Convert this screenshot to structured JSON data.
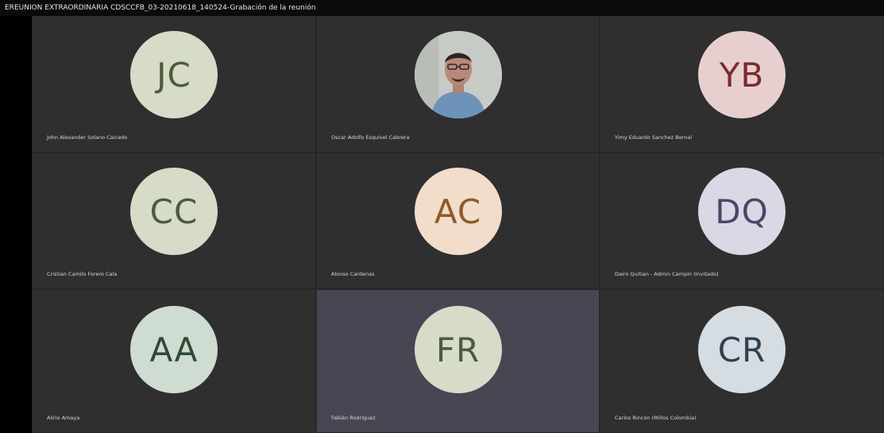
{
  "window": {
    "title": "EREUNION EXTRAORDINARIA CDSCCFB_03-20210618_140524-Grabación de la reunión"
  },
  "participants": [
    {
      "initials": "JC",
      "name": "John Alexander Solano Caicedo",
      "bg": "#d7dcc8",
      "fg": "#4e5a3a"
    },
    {
      "initials": "",
      "name": "Oscar Adolfo Esquivel Cabrera",
      "bg": "#c9ccc9",
      "fg": "#000000"
    },
    {
      "initials": "YB",
      "name": "Yimy Eduardo Sanchez Bernal",
      "bg": "#e8cfcf",
      "fg": "#7a2a2e"
    },
    {
      "initials": "CC",
      "name": "Cristian Camilo Forero Cala",
      "bg": "#d7dcc8",
      "fg": "#4e5a3a"
    },
    {
      "initials": "AC",
      "name": "Alonso Cardenas",
      "bg": "#f2ddcb",
      "fg": "#8e5a2c"
    },
    {
      "initials": "DQ",
      "name": "Dairo Quitian - Admin Campin (Invitado)",
      "bg": "#dad8e4",
      "fg": "#4a4668"
    },
    {
      "initials": "AA",
      "name": "Alirio Amaya",
      "bg": "#cfdcd1",
      "fg": "#2f4a37"
    },
    {
      "initials": "FR",
      "name": "Fabián Rodríguez",
      "bg": "#d7dcc8",
      "fg": "#4e5a3a"
    },
    {
      "initials": "CR",
      "name": "Carlos Rincón (Millos Colombia)",
      "bg": "#d5dce2",
      "fg": "#2f4150"
    }
  ]
}
